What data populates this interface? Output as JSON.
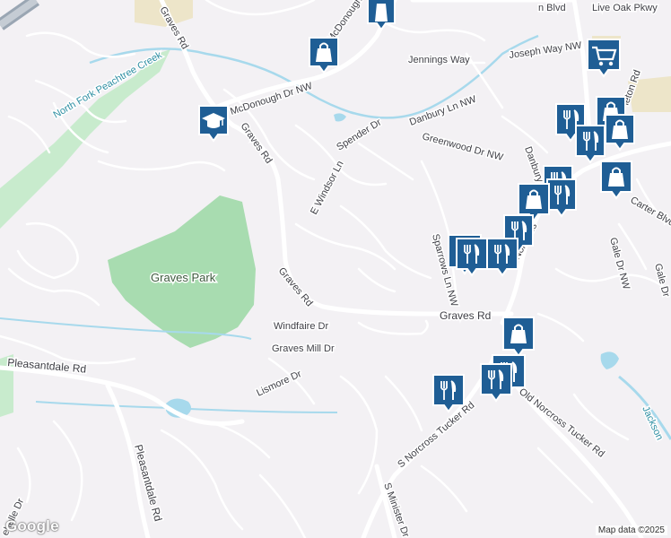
{
  "map": {
    "labels": {
      "graves_rd_nw": "Graves Rd",
      "graves_rd_center": "Graves Rd",
      "graves_rd_east": "Graves Rd",
      "mcdonough_dr": "McDonough Dr NW",
      "mcdonough_short": "McDonough",
      "jennings_way": "Jennings Way",
      "joseph_way": "Joseph Way NW",
      "blvd_top": "n Blvd",
      "live_oak": "Live Oak Pkwy",
      "danbury_ln": "Danbury Ln NW",
      "spender_dr": "Spender Dr",
      "greenwood_dr": "Greenwood Dr NW",
      "e_windsor": "E Windsor Ln",
      "sparrows_ln": "Sparrows Ln NW",
      "gale_dr": "Gale Dr NW",
      "gale_dr_short": "Gale Dr",
      "windfaire_dr": "Windfaire Dr",
      "graves_mill": "Graves Mill Dr",
      "lismore_dr": "Lismore Dr",
      "pleasantdale_rd_w": "Pleasantdale Rd",
      "pleasantdale_rd_s": "Pleasantdale Rd",
      "s_norcross_tucker": "S Norcross Tucker Rd",
      "old_norcross_tucker": "Old Norcross Tucker Rd",
      "norcross_vertical": "Norcross",
      "s_minister": "S Minister Dr",
      "carter_blvd": "Carter Blvd",
      "jackson": "Jackson",
      "danbury_short": "Danbury",
      "carleton": "leton Rd",
      "shelle": "ehelle Dr",
      "creek": "North Fork Peachtree Creek",
      "park": "Graves Park"
    },
    "icons": {
      "shopping": "shopping-bag-icon",
      "school": "graduation-cap-icon",
      "restaurant": "fork-knife-icon",
      "grocery": "shopping-cart-icon"
    },
    "colors": {
      "land": "#f3f1f4",
      "road": "#ffffff",
      "road_major": "#fefefe",
      "park": "#a8dcb0",
      "wooded": "#c8ebcd",
      "water": "#a7d9ec",
      "pin": "#1f5e95",
      "highway": "#9aa6b3"
    }
  },
  "footer": {
    "logo": "Google",
    "attribution": "Map data ©2025"
  }
}
